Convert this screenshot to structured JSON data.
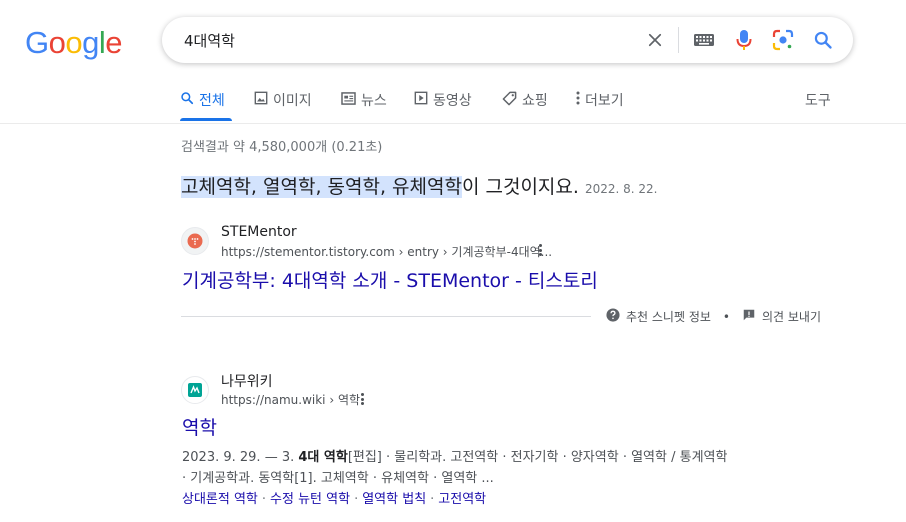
{
  "logo": {
    "letters": [
      "G",
      "o",
      "o",
      "g",
      "l",
      "e"
    ],
    "colors": [
      "#4285f4",
      "#ea4335",
      "#fbbc05",
      "#4285f4",
      "#34a853",
      "#ea4335"
    ]
  },
  "search": {
    "query": "4대역학",
    "icons": [
      "close-icon",
      "keyboard-icon",
      "mic-icon",
      "lens-icon",
      "search-icon"
    ]
  },
  "tabs": [
    {
      "label": "전체",
      "icon": "search-icon",
      "active": true
    },
    {
      "label": "이미지",
      "icon": "image-icon"
    },
    {
      "label": "뉴스",
      "icon": "news-icon"
    },
    {
      "label": "동영상",
      "icon": "video-icon"
    },
    {
      "label": "쇼핑",
      "icon": "tag-icon"
    },
    {
      "label": "더보기",
      "icon": "more-icon"
    }
  ],
  "tools_label": "도구",
  "stats": "검색결과 약 4,580,000개 (0.21초)",
  "featured_snippet": {
    "highlight": "고체역학, 열역학, 동역학, 유체역학",
    "rest": "이 그것이지요.",
    "date": "2022. 8. 22.",
    "site_name": "STEMentor",
    "url": "https://stementor.tistory.com › entry › 기계공학부-4대역...",
    "title": "기계공학부: 4대역학 소개 - STEMentor - 티스토리",
    "about_label": "추천 스니펫 정보",
    "separator": "•",
    "feedback_label": "의견 보내기"
  },
  "result2": {
    "site_name": "나무위키",
    "url": "https://namu.wiki › 역학",
    "title": "역학",
    "line1_prefix": "2023. 9. 29. — 3. ",
    "line1_bold": "4대 역학",
    "line1_rest": "[편집] · 물리학과. 고전역학 · 전자기학 · 양자역학 · 열역학 / 통계역학",
    "line2": "· 기계공학과. 동역학[1]. 고체역학 · 유체역학 · 열역학 ...",
    "sitelinks": [
      "상대론적 역학",
      "수정 뉴턴 역학",
      "열역학 법칙",
      "고전역학"
    ],
    "sitelink_sep": "·"
  }
}
